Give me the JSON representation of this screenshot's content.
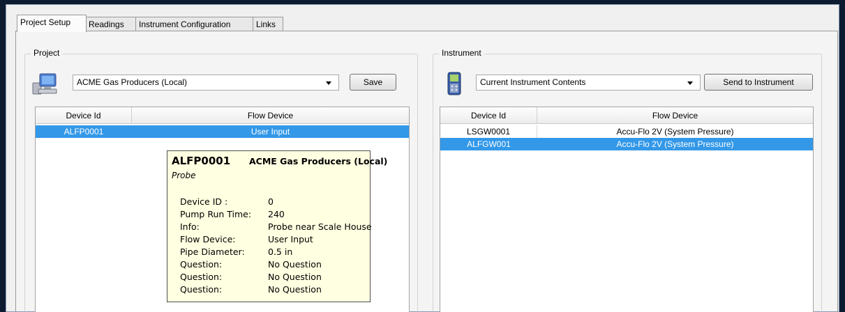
{
  "tabs": [
    {
      "label": "Project Setup",
      "active": true
    },
    {
      "label": "Readings",
      "active": false
    },
    {
      "label": "Instrument Configuration",
      "active": false
    },
    {
      "label": "Links",
      "active": false
    }
  ],
  "project": {
    "group_title": "Project",
    "icon": "computer-icon",
    "selected": "ACME Gas Producers (Local)",
    "save_label": "Save",
    "columns": [
      "Device Id",
      "Flow Device"
    ],
    "rows": [
      {
        "device_id": "ALFP0001",
        "flow_device": "User Input",
        "selected": true
      }
    ]
  },
  "instrument": {
    "group_title": "Instrument",
    "icon": "handheld-device-icon",
    "selected": "Current Instrument Contents",
    "send_label": "Send to Instrument",
    "columns": [
      "Device Id",
      "Flow Device"
    ],
    "rows": [
      {
        "device_id": "LSGW0001",
        "flow_device": "Accu-Flo 2V (System Pressure)",
        "selected": false
      },
      {
        "device_id": "ALFGW001",
        "flow_device": "Accu-Flo 2V (System Pressure)",
        "selected": true
      }
    ]
  },
  "tooltip": {
    "device_id": "ALFP0001",
    "project": "ACME Gas Producers (Local)",
    "type": "Probe",
    "fields": [
      {
        "label": "Device ID :",
        "value": "0"
      },
      {
        "label": "Pump Run Time:",
        "value": "240"
      },
      {
        "label": "Info:",
        "value": "Probe near Scale House"
      },
      {
        "label": "Flow Device:",
        "value": "User Input"
      },
      {
        "label": "Pipe Diameter:",
        "value": "0.5 in"
      },
      {
        "label": "Question:",
        "value": "No Question"
      },
      {
        "label": "Question:",
        "value": "No Question"
      },
      {
        "label": "Question:",
        "value": "No Question"
      }
    ]
  },
  "colors": {
    "selection": "#3398e8",
    "tooltip_bg": "#ffffe1",
    "window_border": "#0d1b30"
  }
}
